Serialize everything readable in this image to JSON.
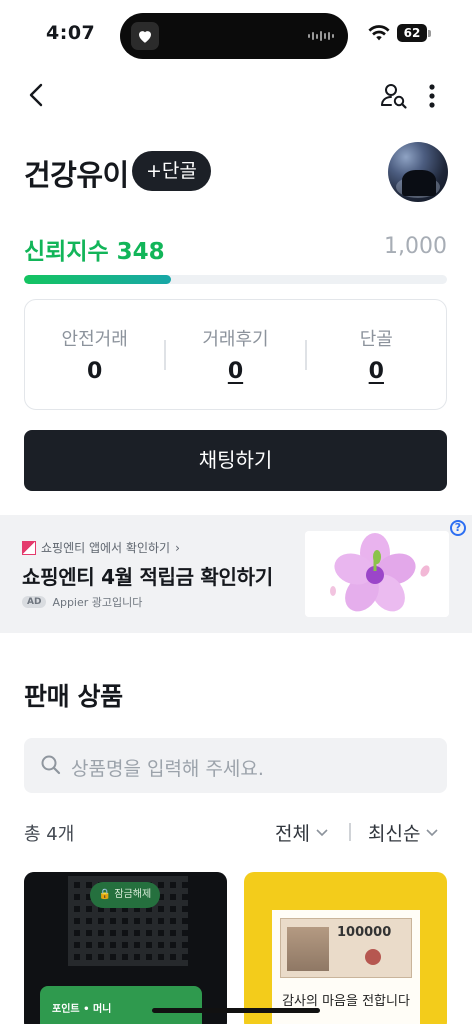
{
  "status_bar": {
    "time": "4:07",
    "battery": "62",
    "icons": [
      "heart-app-icon",
      "wifi-icon",
      "battery-icon"
    ]
  },
  "nav": {
    "icons": [
      "back-arrow-icon",
      "profile-search-icon",
      "more-vertical-icon"
    ]
  },
  "profile": {
    "name": "건강유이",
    "follow_button": "+단골"
  },
  "trust": {
    "label": "신뢰지수",
    "score": "348",
    "max": "1,000",
    "progress_fraction": 0.348,
    "accent_color": "#12b559"
  },
  "stats": [
    {
      "label": "안전거래",
      "value": "0"
    },
    {
      "label": "거래후기",
      "value": "0"
    },
    {
      "label": "단골",
      "value": "0"
    }
  ],
  "chat_button": "채팅하기",
  "ad": {
    "brand_line": "쇼핑엔티 앱에서 확인하기",
    "title": "쇼핑엔티 4월 적립금 확인하기",
    "badge": "AD",
    "meta": "Appier 광고입니다",
    "help": "?"
  },
  "products": {
    "section_title": "판매 상품",
    "search_placeholder": "상품명을 입력해 주세요.",
    "count": "총 4개",
    "filter_all": "전체",
    "filter_sort": "최신순",
    "cards": [
      {
        "pill": "잠금해제",
        "strip": "포인트 • 머니"
      },
      {
        "amount": "100000",
        "caption": "감사의 마음을 전합니다"
      }
    ]
  }
}
